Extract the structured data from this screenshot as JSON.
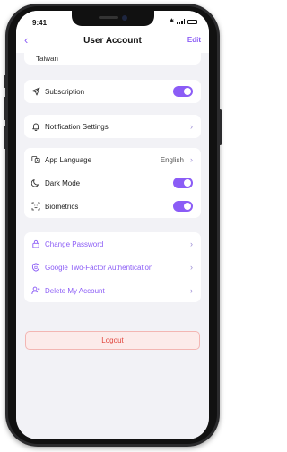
{
  "status_bar": {
    "time": "9:41"
  },
  "header": {
    "title": "User Account",
    "edit_label": "Edit"
  },
  "profile": {
    "country": "Taiwan"
  },
  "settings": {
    "subscription": {
      "label": "Subscription",
      "enabled": true
    },
    "notification_settings": {
      "label": "Notification Settings"
    },
    "app_language": {
      "label": "App Language",
      "value": "English"
    },
    "dark_mode": {
      "label": "Dark Mode",
      "enabled": true
    },
    "biometrics": {
      "label": "Biometrics",
      "enabled": true
    }
  },
  "security": {
    "change_password": {
      "label": "Change Password"
    },
    "two_factor": {
      "label": "Google Two-Factor Authentication"
    },
    "delete_account": {
      "label": "Delete My Account"
    }
  },
  "logout_label": "Logout",
  "colors": {
    "accent": "#8b5cf6",
    "danger": "#e0443c",
    "background": "#f2f2f6"
  }
}
